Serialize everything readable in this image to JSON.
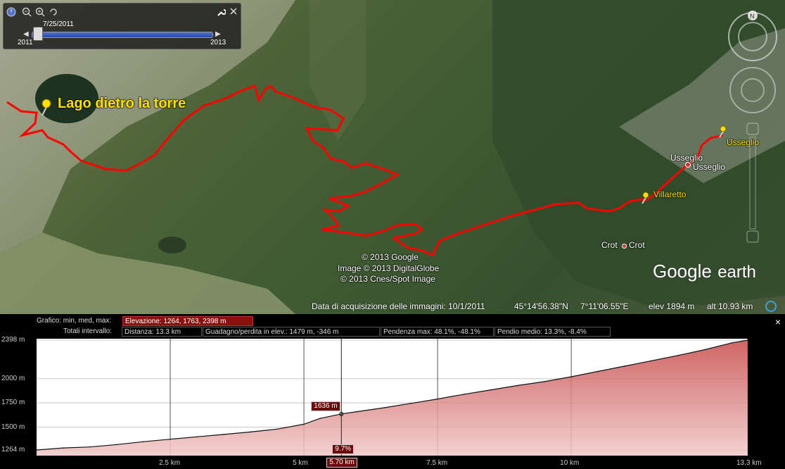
{
  "timeslider": {
    "current_date": "7/25/2011",
    "start_year": "2011",
    "end_year": "2013"
  },
  "map": {
    "place_labels": {
      "lake": "Lago dietro la torre",
      "usseglio_pin": "Usseglio",
      "usseglio_a": "Usseglio",
      "usseglio_b": "Usseglio",
      "villaretto": "Villaretto",
      "crot_a": "Crot",
      "crot_b": "Crot"
    },
    "copyright": {
      "line1": "© 2013 Google",
      "line2": "Image © 2013 DigitalGlobe",
      "line3": "© 2013 Cnes/Spot Image"
    },
    "logo": {
      "brand": "Google",
      "product": "earth"
    },
    "status": {
      "acquisition": "Data di acquisizione delle immagini: 10/1/2011",
      "lat": "45°14'56.38\"N",
      "lon": "7°11'06.55\"E",
      "elev": "elev 1894 m",
      "alt": "alt  10.93 km"
    },
    "route_color": "#ff0000"
  },
  "profile": {
    "row1": {
      "label": "Grafico: min, med, max:",
      "elevation": "Elevazione: 1264, 1763, 2398 m"
    },
    "row2": {
      "label": "Totali intervallo:",
      "distance": "Distanza: 13.3 km",
      "gain": "Guadagno/perdita in elev.: 1479 m, -346 m",
      "slope_max": "Pendenza max: 48.1%, -48.1%",
      "slope_avg": "Pendio medio: 13.3%, -8.4%"
    },
    "close_icon": "×",
    "cursor": {
      "elevation_tag": "1636 m",
      "slope_tag": "9.7%",
      "distance_tag": "5.70 km"
    }
  },
  "chart_data": {
    "type": "area",
    "x_unit": "km",
    "y_unit": "m",
    "x": [
      0,
      0.5,
      1,
      1.5,
      2,
      2.5,
      3,
      3.5,
      4,
      4.5,
      5,
      5.3,
      5.7,
      6,
      6.5,
      7,
      7.5,
      8,
      8.5,
      9,
      9.5,
      10,
      10.5,
      11,
      11.5,
      12,
      12.5,
      13,
      13.3
    ],
    "y": [
      1264,
      1285,
      1295,
      1320,
      1350,
      1375,
      1400,
      1425,
      1450,
      1480,
      1530,
      1590,
      1636,
      1660,
      1700,
      1745,
      1790,
      1840,
      1885,
      1930,
      1970,
      2020,
      2075,
      2130,
      2185,
      2240,
      2300,
      2370,
      2398
    ],
    "yticks": [
      "2398 m",
      "2000 m",
      "1750 m",
      "1500 m",
      "1264 m"
    ],
    "ytick_values": [
      2398,
      2000,
      1750,
      1500,
      1264
    ],
    "xticks": [
      "2.5 km",
      "5 km",
      "7.5 km",
      "10 km",
      "13.3 km"
    ],
    "xtick_values": [
      2.5,
      5,
      7.5,
      10,
      13.3
    ],
    "ylim": [
      1264,
      2398
    ],
    "xlim": [
      0,
      13.3
    ],
    "cursor_x": 5.7,
    "fill_color": "#c84a4a",
    "grid": true
  }
}
